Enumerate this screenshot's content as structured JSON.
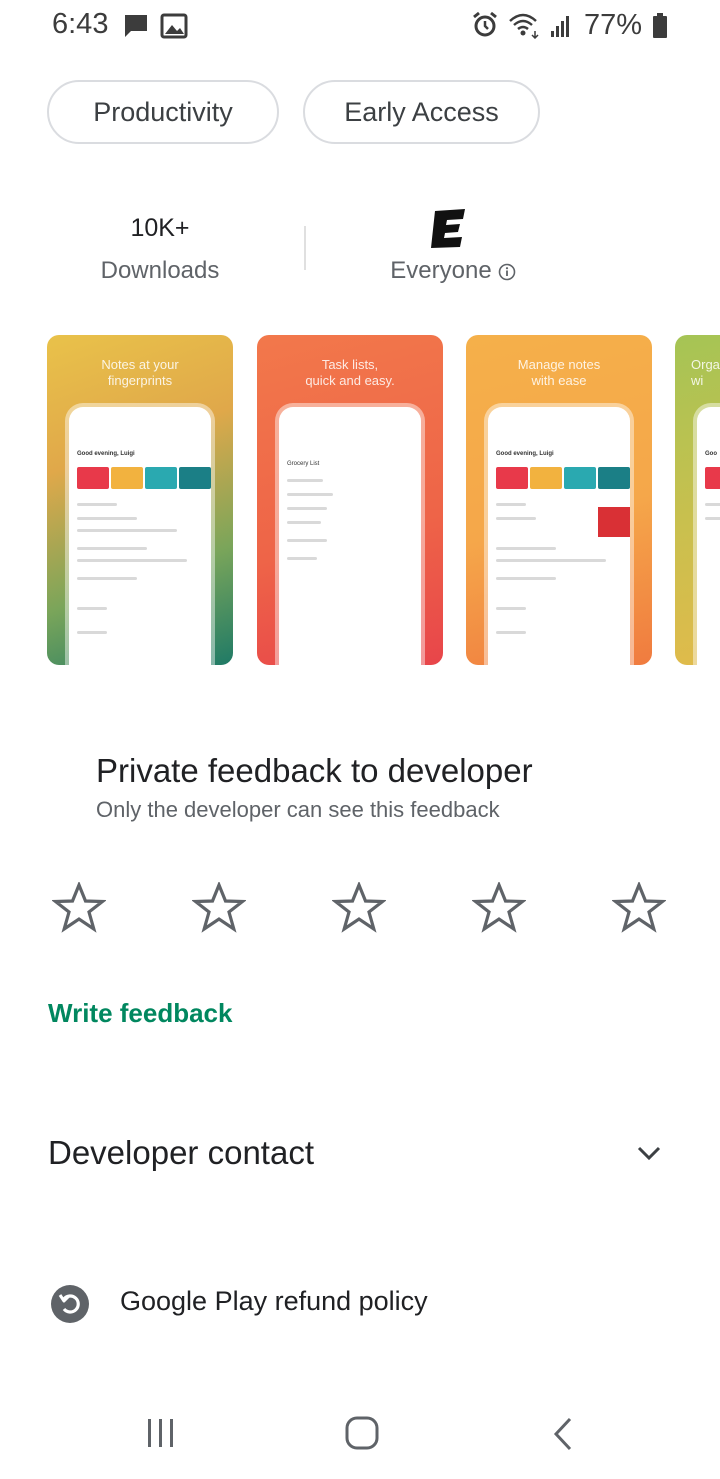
{
  "status_bar": {
    "time": "6:43",
    "battery": "77%",
    "icons": [
      "message-icon",
      "gallery-icon",
      "alarm-icon",
      "wifi-icon",
      "signal-icon",
      "battery-icon"
    ]
  },
  "chips": [
    "Productivity",
    "Early Access"
  ],
  "stats": {
    "downloads_value": "10K+",
    "downloads_label": "Downloads",
    "rating_label": "Everyone",
    "rating_icon": "esrb-e-icon"
  },
  "screenshots": [
    {
      "caption_line1": "Notes at your",
      "caption_line2": "fingerprints",
      "phone_header": "Good evening, Luigi",
      "colors": [
        "#e9c24a",
        "#1f7a66"
      ]
    },
    {
      "caption_line1": "Task lists,",
      "caption_line2": "quick and easy.",
      "phone_header": "Grocery List",
      "colors": [
        "#f2784b",
        "#e8454a"
      ]
    },
    {
      "caption_line1": "Manage notes",
      "caption_line2": "with ease",
      "phone_header": "Good evening, Luigi",
      "colors": [
        "#f5b04a",
        "#f07b3f"
      ]
    },
    {
      "caption_line1": "Orga",
      "caption_line2": "wi",
      "phone_header": "Goo",
      "colors": [
        "#a5c455",
        "#e6b94a"
      ]
    }
  ],
  "feedback": {
    "title": "Private feedback to developer",
    "subtitle": "Only the developer can see this feedback",
    "star_count": 5,
    "write_label": "Write feedback",
    "accent_color": "#01875f"
  },
  "developer_contact": {
    "label": "Developer contact",
    "icon": "chevron-down-icon"
  },
  "refund": {
    "label": "Google Play refund policy",
    "icon": "refund-icon"
  },
  "nav_bar": {
    "items": [
      "recents-icon",
      "home-icon",
      "back-icon"
    ]
  }
}
